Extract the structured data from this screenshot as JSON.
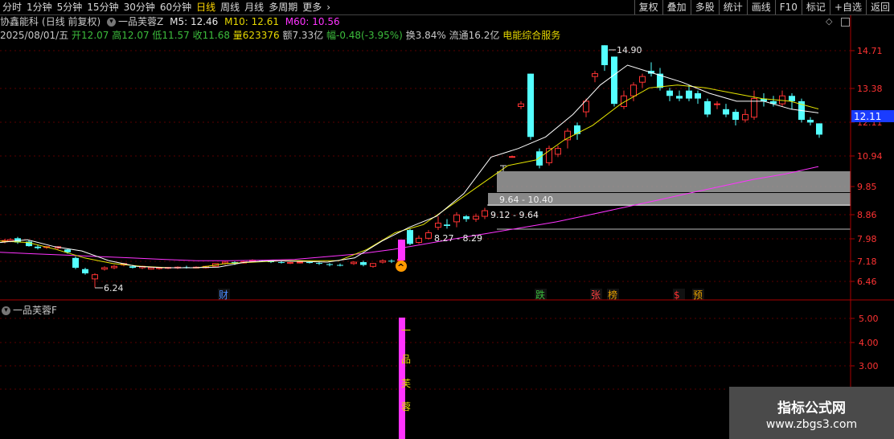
{
  "toolbar": {
    "periods": [
      "分时",
      "1分钟",
      "5分钟",
      "15分钟",
      "30分钟",
      "60分钟",
      "日线",
      "周线",
      "月线",
      "多周期",
      "更多"
    ],
    "active_period": "日线",
    "more_arrow": "›",
    "buttons": [
      "复权",
      "叠加",
      "多股",
      "统计",
      "画线",
      "F10",
      "标记",
      "+自选",
      "返回"
    ]
  },
  "header": {
    "stock_name": "协鑫能科",
    "chart_mode": "(日线 前复权)",
    "indicator": "一品芙蓉Z",
    "ma5": "M5: 12.46",
    "ma10": "M10: 12.61",
    "ma60": "M60: 10.56",
    "diamond_icon": "◇"
  },
  "quote": {
    "date": "2025/08/01/五",
    "open": "开12.07",
    "high": "高12.07",
    "low": "低11.57",
    "close": "收11.68",
    "volume": "量623376",
    "amount": "额7.33亿",
    "change": "幅-0.48(-3.95%)",
    "turnover": "换3.84%",
    "float_cap": "流通16.2亿",
    "sector": "电能综合服务"
  },
  "price_axis": {
    "ticks": [
      "14.71",
      "13.38",
      "12.11",
      "10.94",
      "9.85",
      "8.86",
      "7.98",
      "7.18",
      "6.46"
    ],
    "current_price": "12.11",
    "colors": {
      "grid": "#5a0000",
      "axis_text": "#ff3333",
      "current_bg": "#1a3cff"
    }
  },
  "annotations": {
    "high": "14.90",
    "low": "6.24",
    "zone1": "9.64 - 10.40",
    "zone2": "9.12 - 9.64",
    "zone3": "8.27 - 8.29"
  },
  "event_markers": [
    {
      "text": "财",
      "color": "#4a8cff"
    },
    {
      "text": "跌",
      "color": "#3cbc3c"
    },
    {
      "text": "张",
      "color": "#ff4040"
    },
    {
      "text": "榜",
      "color": "#e6a000"
    },
    {
      "text": "$",
      "color": "#ff3030"
    },
    {
      "text": "预",
      "color": "#e6a000"
    }
  ],
  "signal_icon": "^",
  "sub_panel": {
    "title": "一品芙蓉F",
    "ticks": [
      "5.00",
      "4.00",
      "3.00"
    ],
    "bar_text": [
      "一",
      "品",
      "芙",
      "蓉"
    ]
  },
  "watermark": {
    "title": "指标公式网",
    "url": "www.zbgs3.com"
  },
  "colors": {
    "up_candle": "#ff3333",
    "down_candle": "#54ffff",
    "ma5_line": "#ffffff",
    "ma10_line": "#e6e600",
    "ma60_line": "#ff33ff",
    "zone_fill": "#a0a0a0"
  },
  "chart_data": {
    "type": "candlestick",
    "series": [
      {
        "name": "M5",
        "values": [
          7.85,
          7.95,
          7.7,
          7.55,
          7.2,
          7.0,
          6.95,
          6.95,
          6.97,
          7.15,
          7.2,
          7.18,
          7.15,
          7.3,
          7.9,
          8.4,
          8.8,
          9.6,
          10.9,
          11.2,
          11.6,
          12.4,
          13.5,
          14.2,
          13.9,
          13.6,
          13.2,
          12.9,
          12.9,
          12.6,
          12.46
        ]
      },
      {
        "name": "M10",
        "values": [
          7.9,
          7.85,
          7.6,
          7.3,
          7.1,
          7.0,
          6.95,
          6.95,
          7.1,
          7.15,
          7.2,
          7.2,
          7.2,
          7.6,
          8.2,
          8.5,
          9.2,
          9.9,
          10.6,
          10.8,
          11.5,
          12.0,
          12.8,
          13.4,
          13.5,
          13.4,
          13.2,
          13.0,
          12.9,
          12.61
        ]
      },
      {
        "name": "M60",
        "values": [
          7.5,
          7.45,
          7.4,
          7.35,
          7.3,
          7.25,
          7.2,
          7.2,
          7.22,
          7.25,
          7.35,
          7.45,
          7.6,
          7.8,
          8.0,
          8.2,
          8.4,
          8.6,
          8.85,
          9.1,
          9.35,
          9.6,
          9.85,
          10.1,
          10.3,
          10.56
        ]
      }
    ]
  }
}
